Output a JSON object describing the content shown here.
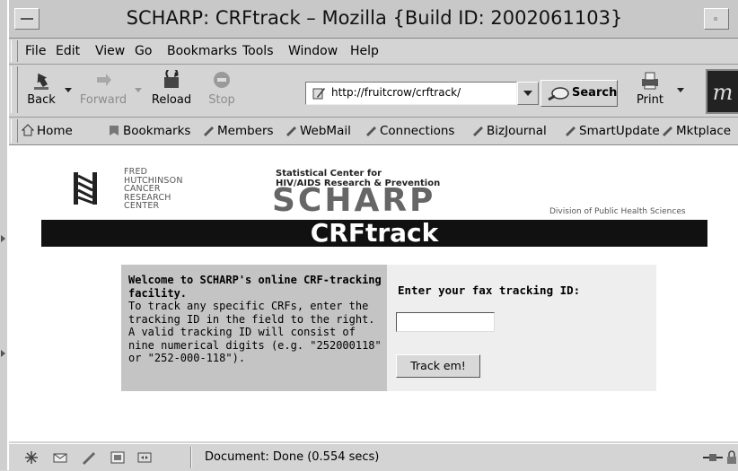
{
  "window": {
    "title": "SCHARP: CRFtrack – Mozilla {Build ID: 2002061103}"
  },
  "menubar": {
    "items": [
      {
        "label": "File"
      },
      {
        "label": "Edit"
      },
      {
        "label": "View"
      },
      {
        "label": "Go"
      },
      {
        "label": "Bookmarks"
      },
      {
        "label": "Tools"
      },
      {
        "label": "Window"
      },
      {
        "label": "Help"
      }
    ]
  },
  "navbar": {
    "back_label": "Back",
    "forward_label": "Forward",
    "reload_label": "Reload",
    "stop_label": "Stop",
    "url": "http://fruitcrow/crftrack/",
    "search_label": "Search",
    "print_label": "Print"
  },
  "personal_toolbar": {
    "items": [
      {
        "label": "Home",
        "icon": "home-icon"
      },
      {
        "label": "Bookmarks",
        "icon": "bookmarks-icon"
      },
      {
        "label": "Members",
        "icon": "link-icon"
      },
      {
        "label": "WebMail",
        "icon": "link-icon"
      },
      {
        "label": "Connections",
        "icon": "link-icon"
      },
      {
        "label": "BizJournal",
        "icon": "link-icon"
      },
      {
        "label": "SmartUpdate",
        "icon": "link-icon"
      },
      {
        "label": "Mktplace",
        "icon": "link-icon"
      }
    ]
  },
  "page": {
    "fhcrc_lines": [
      "FRED",
      "HUTCHINSON",
      "CANCER",
      "RESEARCH",
      "CENTER"
    ],
    "scharp_subtitle_1": "Statistical Center for",
    "scharp_subtitle_2": "HIV/AIDS Research & Prevention",
    "scharp_logo": "SCHARP",
    "division": "Division of Public Health Sciences",
    "banner": "CRFtrack",
    "welcome_bold": "Welcome to SCHARP's online CRF-tracking facility.",
    "welcome_body": "To track any specific CRFs, enter the tracking ID in the field to the right. A valid tracking ID will consist of nine numerical digits (e.g. \"252000118\" or \"252-000-118\").",
    "prompt": "Enter your fax tracking ID:",
    "tracking_value": "",
    "track_button": "Track em!"
  },
  "statusbar": {
    "text": "Document: Done (0.554 secs)"
  }
}
